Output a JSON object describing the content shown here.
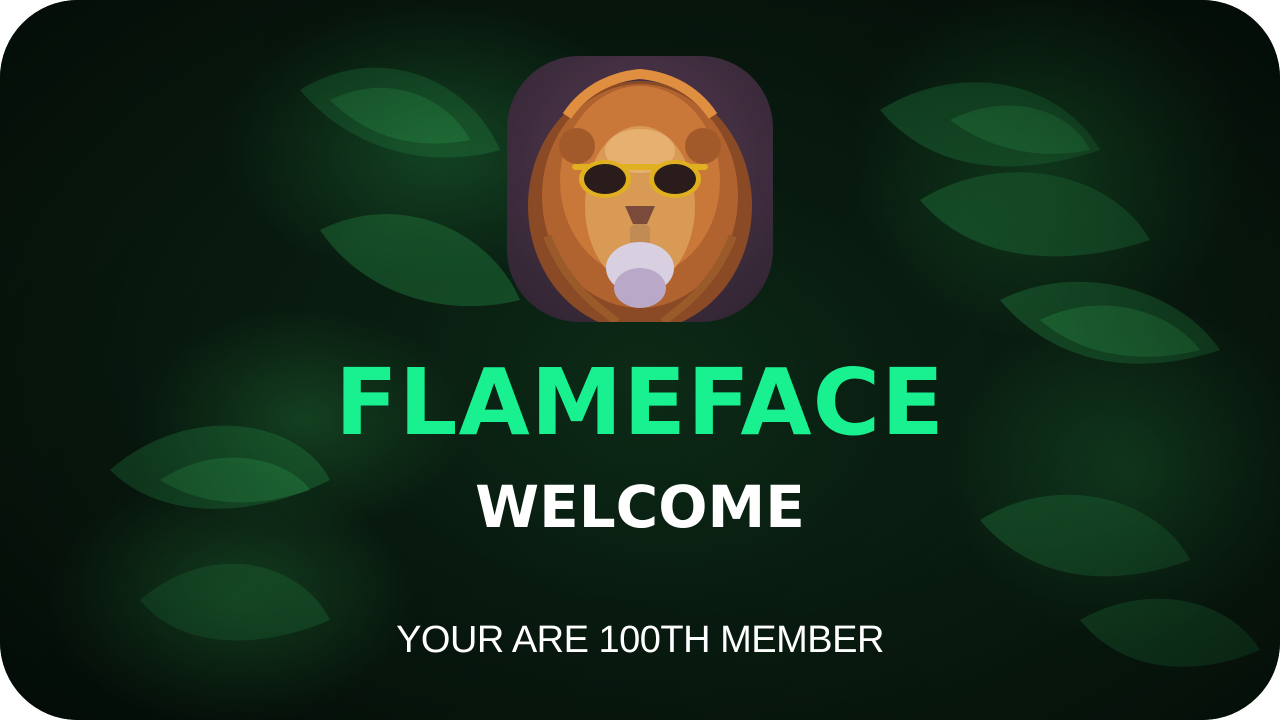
{
  "card": {
    "brand_name": "FLAMEFACE",
    "greeting": "WELCOME",
    "member_text": "YOUR ARE 100TH MEMBER",
    "avatar_icon": "lion-with-sunglasses-avatar",
    "background": "dark-jungle-leaves"
  },
  "colors": {
    "accent": "#19f08f",
    "text": "#ffffff",
    "background": "#06120c"
  }
}
